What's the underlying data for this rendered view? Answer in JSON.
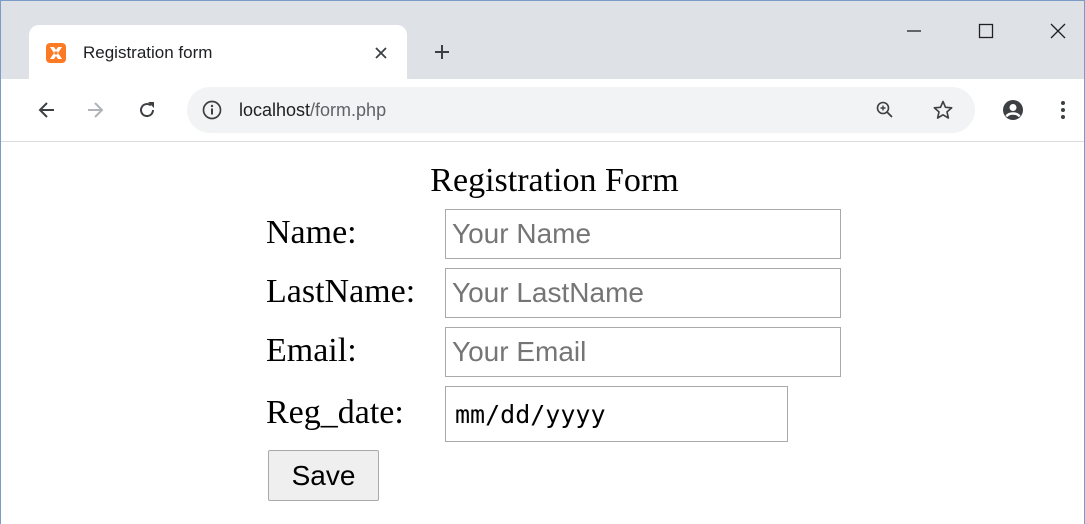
{
  "browser": {
    "tab": {
      "title": "Registration form",
      "favicon": "xampp-icon"
    },
    "address": {
      "host": "localhost",
      "path": "/form.php"
    },
    "window_controls": [
      "minimize",
      "maximize",
      "close"
    ]
  },
  "form": {
    "title": "Registration Form",
    "fields": [
      {
        "label": "Name:",
        "placeholder": "Your Name",
        "value": ""
      },
      {
        "label": "LastName:",
        "placeholder": "Your LastName",
        "value": ""
      },
      {
        "label": "Email:",
        "placeholder": "Your Email",
        "value": ""
      }
    ],
    "reg_date": {
      "label": "Reg_date:",
      "placeholder": "mm/dd/yyyy"
    },
    "save_label": "Save"
  }
}
